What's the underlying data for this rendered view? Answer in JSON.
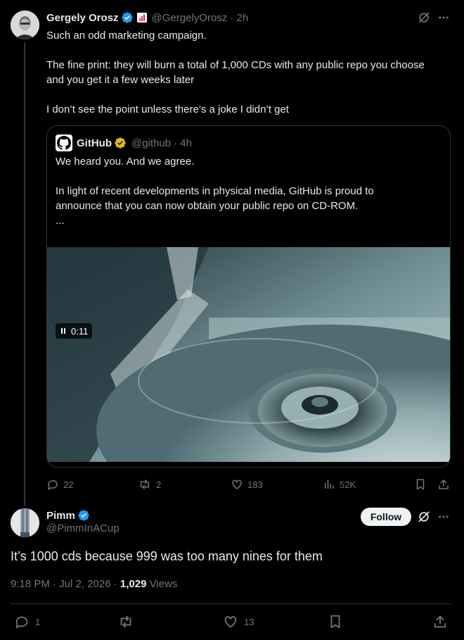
{
  "tweet": {
    "author_name": "Gergely Orosz",
    "author_handle": "@GergelyOrosz",
    "time": "· 2h",
    "lines": [
      "Such an odd marketing campaign.",
      "The fine print: they will burn a total of 1,000 CDs with any public repo you choose",
      "and you get it a few weeks later",
      "I don’t see the point unless there’s a joke I didn’t get"
    ],
    "quote": {
      "author_name": "GitHub",
      "author_handle": "@github",
      "time": "· 4h",
      "lines": [
        "We heard you. And we agree.",
        "In light of recent developments in physical media, GitHub is proud to",
        "announce that you can now obtain your public repo on CD-ROM.",
        "..."
      ],
      "video_time": "0:11"
    },
    "stats": {
      "replies": "22",
      "reposts": "2",
      "likes": "183",
      "views": "52K"
    }
  },
  "reply": {
    "author_name": "Pimm",
    "author_handle": "@PimmInACup",
    "follow_label": "Follow",
    "text": "It’s 1000 cds because 999 was too many nines for them",
    "timestamp": "9:18 PM · Jul 2, 2026 · ",
    "view_count": "1,029",
    "views_label": " Views",
    "stats": {
      "replies": "1",
      "likes": "13"
    }
  },
  "colors": {
    "background": "#000000",
    "text": "#e7e9ea",
    "muted": "#71767b",
    "verified_blue": "#1d9bf0",
    "verified_gold": "#e2b719",
    "border": "#2f3336"
  },
  "icons": [
    "verified-badge-icon",
    "org-badge-icon",
    "grok-icon",
    "more-icon",
    "reply-icon",
    "repost-icon",
    "like-icon",
    "views-icon",
    "bookmark-icon",
    "share-icon",
    "pause-icon",
    "github-logo-icon"
  ]
}
